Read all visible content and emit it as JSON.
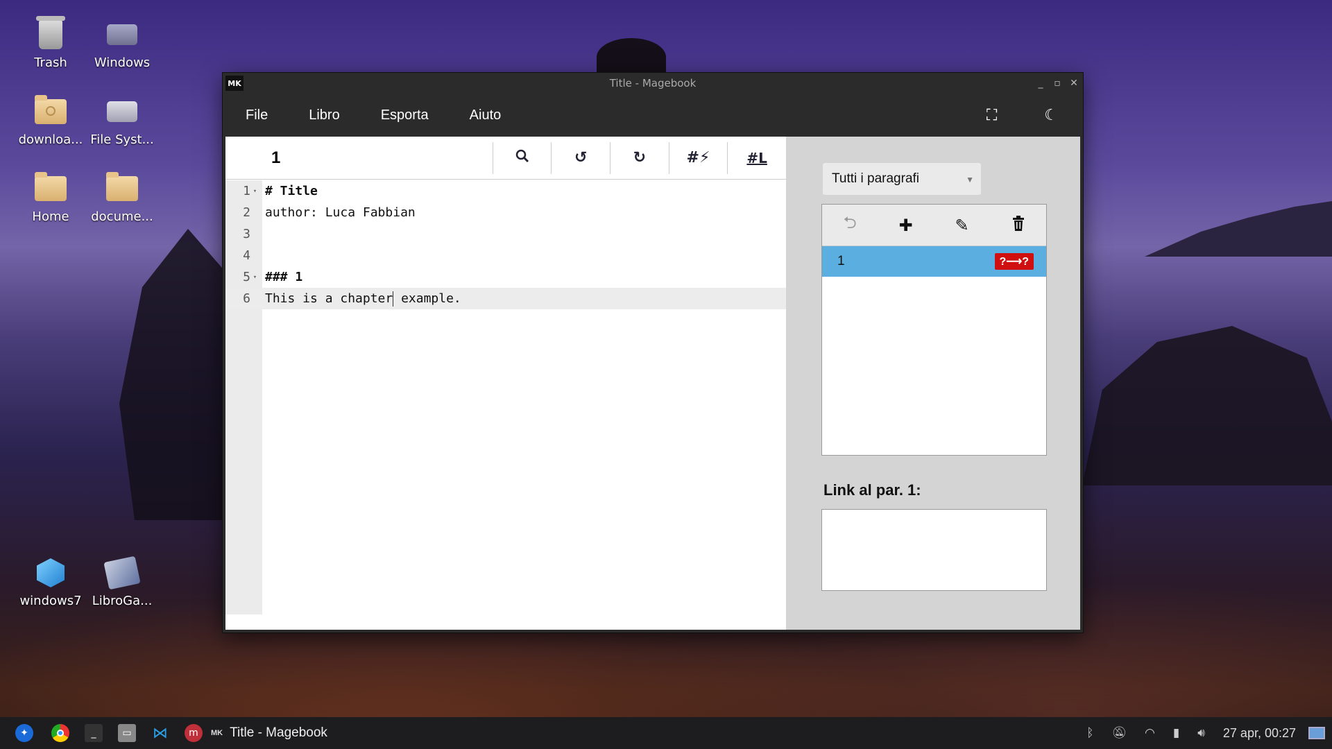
{
  "desktop": {
    "icons": [
      {
        "label": "Trash",
        "icon": "trash-icon"
      },
      {
        "label": "Windows",
        "icon": "drive-icon"
      },
      {
        "label": "downloa...",
        "icon": "folder-download-icon"
      },
      {
        "label": "File Syst...",
        "icon": "drive-icon"
      },
      {
        "label": "Home",
        "icon": "folder-home-icon"
      },
      {
        "label": "docume...",
        "icon": "folder-documents-icon"
      },
      {
        "label": "windows7",
        "icon": "virtualbox-icon"
      },
      {
        "label": "LibroGa...",
        "icon": "gamebook-icon"
      }
    ]
  },
  "window": {
    "logo": "MK",
    "title": "Title - Magebook",
    "menu": [
      "File",
      "Libro",
      "Esporta",
      "Aiuto"
    ]
  },
  "editor": {
    "paragraph_title": "1",
    "toolbar": {
      "hash_lightning": "#⚡",
      "hash_link": "#L"
    },
    "lines": [
      {
        "n": "1",
        "text": "# Title",
        "fold": true,
        "bold": true
      },
      {
        "n": "2",
        "text": "author: Luca Fabbian",
        "fold": false,
        "bold": false
      },
      {
        "n": "3",
        "text": "",
        "fold": false,
        "bold": false
      },
      {
        "n": "4",
        "text": "",
        "fold": false,
        "bold": false
      },
      {
        "n": "5",
        "text": "### 1",
        "fold": true,
        "bold": true
      },
      {
        "n": "6",
        "text_before_cursor": "This is a chapter",
        "text_after_cursor": " example.",
        "fold": false,
        "bold": false
      }
    ]
  },
  "sidebar": {
    "filter_selected": "Tutti i paragrafi",
    "paragraphs": [
      {
        "label": "1",
        "badge": "?⟶?"
      }
    ],
    "links_title": "Link al par. 1:"
  },
  "taskbar": {
    "active_app_logo": "MK",
    "active_app": "Title - Magebook",
    "clock": "27 apr, 00:27"
  },
  "colors": {
    "selection": "#5bafe0",
    "badge": "#d01010",
    "titlebar": "#2b2b2b"
  }
}
